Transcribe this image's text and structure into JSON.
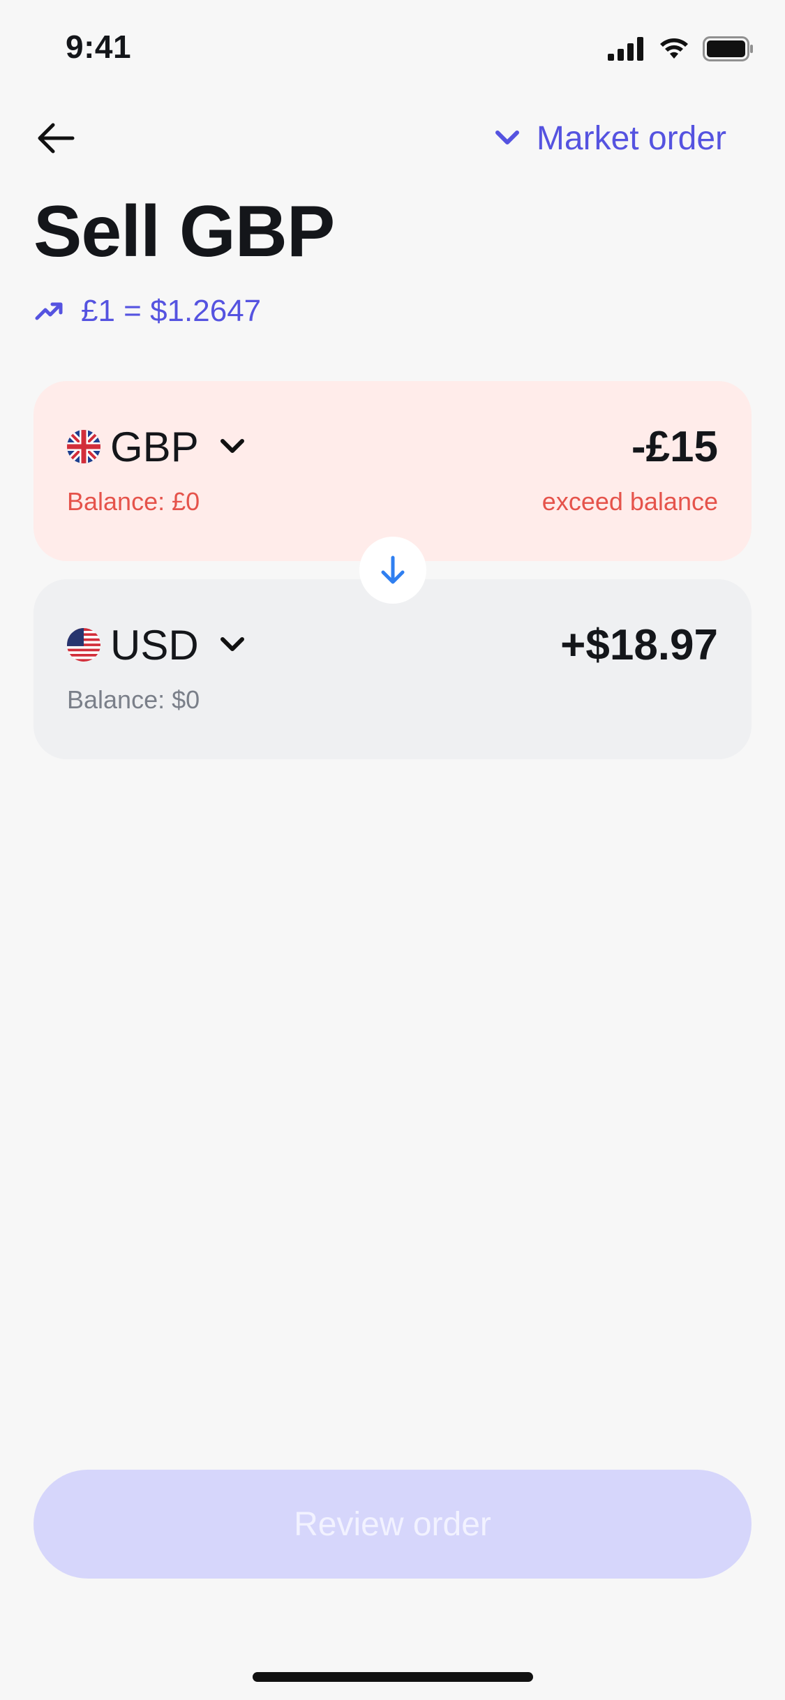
{
  "status_bar": {
    "time": "9:41"
  },
  "header": {
    "order_type_label": "Market order"
  },
  "title": "Sell GBP",
  "rate": {
    "text": "£1 = $1.2647"
  },
  "sell": {
    "currency": "GBP",
    "amount": "-£15",
    "balance": "Balance: £0",
    "warning": "exceed balance"
  },
  "buy": {
    "currency": "USD",
    "amount": "+$18.97",
    "balance": "Balance: $0"
  },
  "review_button": {
    "label": "Review order"
  },
  "colors": {
    "accent": "#5553e0",
    "error": "#e5534b",
    "sell_card_bg": "#ffecea",
    "buy_card_bg": "#eff0f2",
    "button_disabled_bg": "#d6d6fb"
  },
  "icons": {
    "back": "arrow-left-icon",
    "order_type": "chevron-down-icon",
    "rate": "trending-up-icon",
    "swap": "arrow-down-icon"
  }
}
